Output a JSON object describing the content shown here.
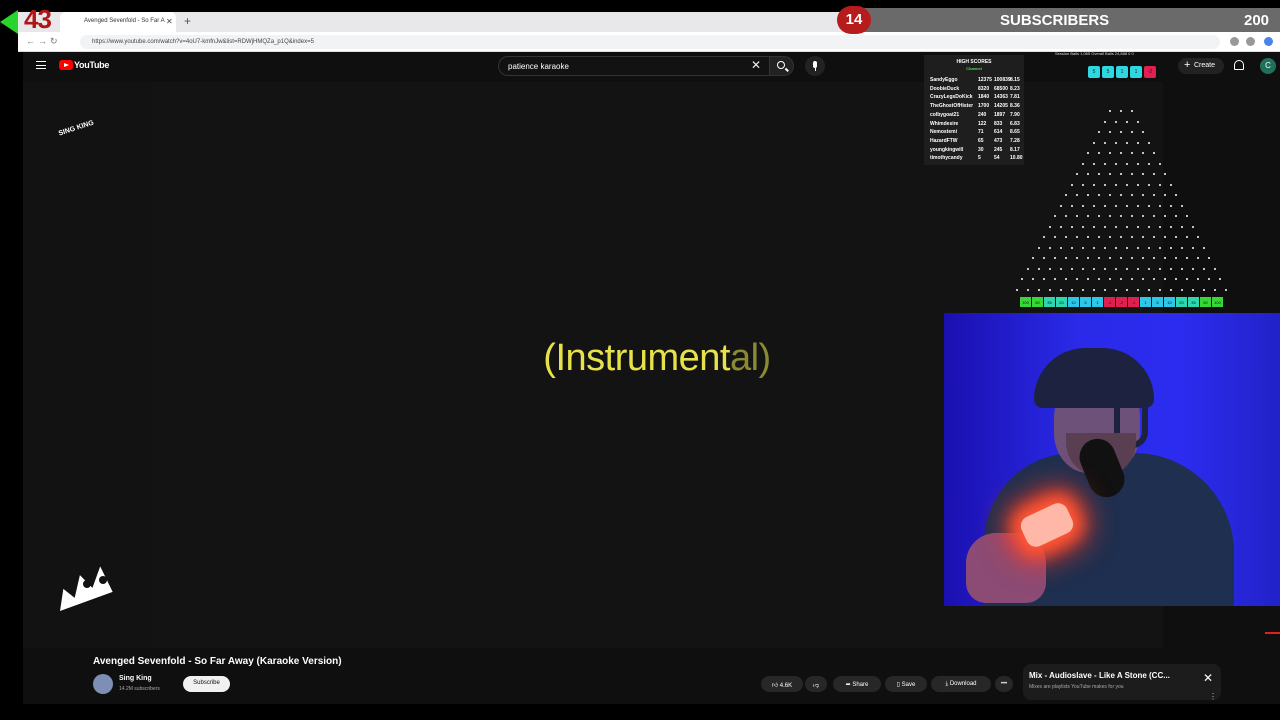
{
  "browser": {
    "tab_title": "Avenged Sevenfold - So Far A",
    "url": "https://www.youtube.com/watch?v=4oU7-kmfnJw&list=RDWjHMQZa_p1Q&index=5"
  },
  "youtube": {
    "brand": "YouTube",
    "search_value": "patience karaoke",
    "create_label": "Create",
    "avatar_letter": "C",
    "video_text_main": "(Instrument",
    "video_text_fade": "al)",
    "logo_text": "SING KING",
    "video_title": "Avenged Sevenfold - So Far Away (Karaoke Version)",
    "channel_name": "Sing King",
    "channel_subs": "14.2M subscribers",
    "subscribe_label": "Subscribe",
    "like_count": "4.6K",
    "share_label": "Share",
    "save_label": "Save",
    "download_label": "Download",
    "mix_title": "Mix - Audioslave - Like A Stone (CC...",
    "mix_subtitle": "Mixes are playlists YouTube makes for you"
  },
  "overlay": {
    "counter": "43",
    "sub_count": "14",
    "sub_label": "SUBSCRIBERS",
    "sub_goal": "200",
    "session_text": "Session Balls   1,065     Overall Balls   24,888     0     0"
  },
  "high_scores": {
    "title": "HIGH SCORES",
    "subtitle": "Channel",
    "rows": [
      {
        "name": "SandyEggo",
        "a": "12375",
        "b": "100839",
        "c": "8.15"
      },
      {
        "name": "DoobieDuck",
        "a": "8320",
        "b": "68500",
        "c": "8.23"
      },
      {
        "name": "CrazyLegsDoKick",
        "a": "1840",
        "b": "14363",
        "c": "7.81"
      },
      {
        "name": "TheGhostOfHister",
        "a": "1700",
        "b": "14205",
        "c": "8.36"
      },
      {
        "name": "colbygoat21",
        "a": "240",
        "b": "1897",
        "c": "7.90"
      },
      {
        "name": "Whimdesire",
        "a": "122",
        "b": "833",
        "c": "6.83"
      },
      {
        "name": "Nemostemi",
        "a": "71",
        "b": "614",
        "c": "8.65"
      },
      {
        "name": "HazardFTW",
        "a": "65",
        "b": "473",
        "c": "7.28"
      },
      {
        "name": "youngkingwill",
        "a": "30",
        "b": "245",
        "c": "8.17"
      },
      {
        "name": "timothycandy",
        "a": "5",
        "b": "54",
        "c": "10.80"
      }
    ]
  },
  "ball_scores": [
    "5",
    "5",
    "1",
    "1",
    "-2"
  ],
  "slot_values": [
    "100",
    "50",
    "35",
    "20",
    "10",
    "5",
    "1",
    "-1",
    "-2",
    "-1",
    "1",
    "5",
    "10",
    "20",
    "35",
    "50",
    "100"
  ],
  "colors": {
    "accent_red": "#b71c1c",
    "youtube_red": "#ff0000",
    "lyric_yellow": "#e8e24a",
    "plinko_green": "#39d639"
  }
}
